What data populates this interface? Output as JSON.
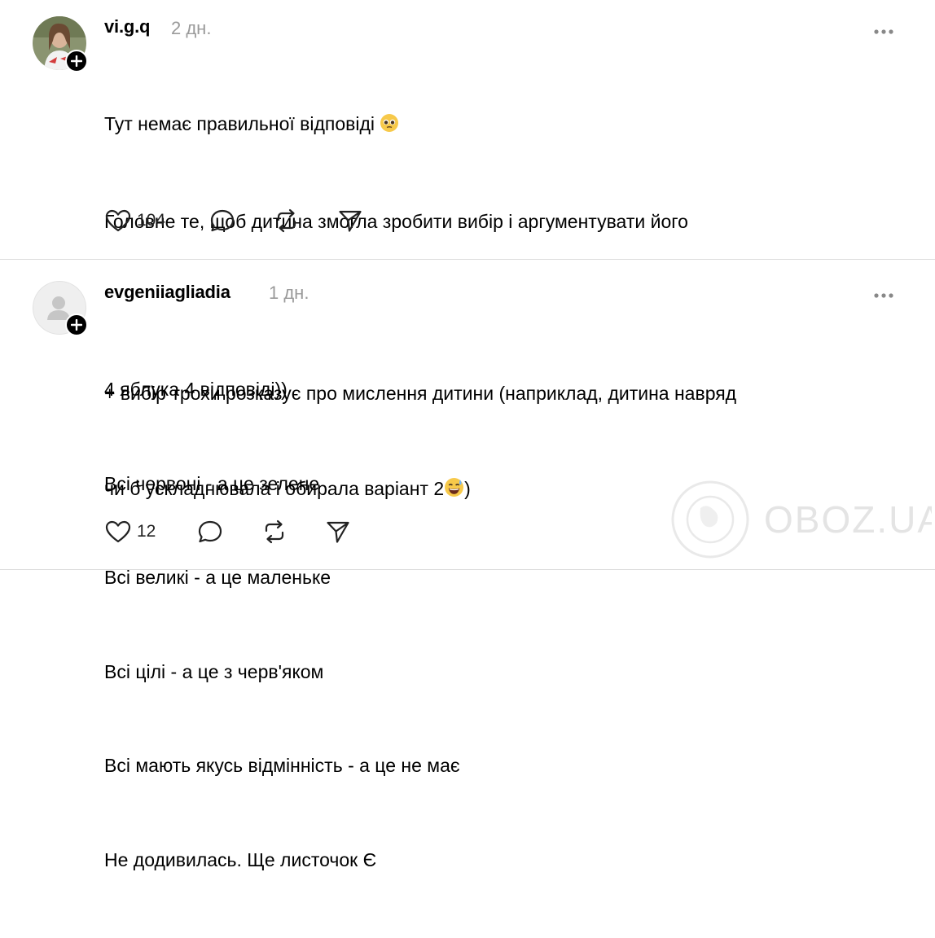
{
  "posts": [
    {
      "username": "vi.g.q",
      "time": "2 дн.",
      "lines": [
        "Тут немає правильної відповіді",
        "Головне те, щоб дитина змогла зробити вибір і аргументувати його",
        "+ вибір трохи розказує про мислення дитини (наприклад, дитина навряд",
        "чи б ускладнювала і обирала варіант 2"
      ],
      "emoji_after_line1": "pleading-face",
      "emoji_before_close_paren": "grinning-sweat-face",
      "line4_close": ")",
      "likes": "104"
    },
    {
      "username": "evgeniiagliadia",
      "time": "1 дн.",
      "lines": [
        "4 яблука 4 відповіді))",
        "Всі червоні - а це зелене",
        "Всі великі - а це маленьке",
        "Всі цілі - а це з черв'яком",
        "Всі мають якусь відмінність - а це не має",
        "Не додивилась. Ще листочок Є"
      ],
      "likes": "12"
    }
  ],
  "watermark": {
    "text": "OBOZ.UA"
  },
  "colors": {
    "divider": "#dcdcdc",
    "muted": "#9a9a9a"
  }
}
